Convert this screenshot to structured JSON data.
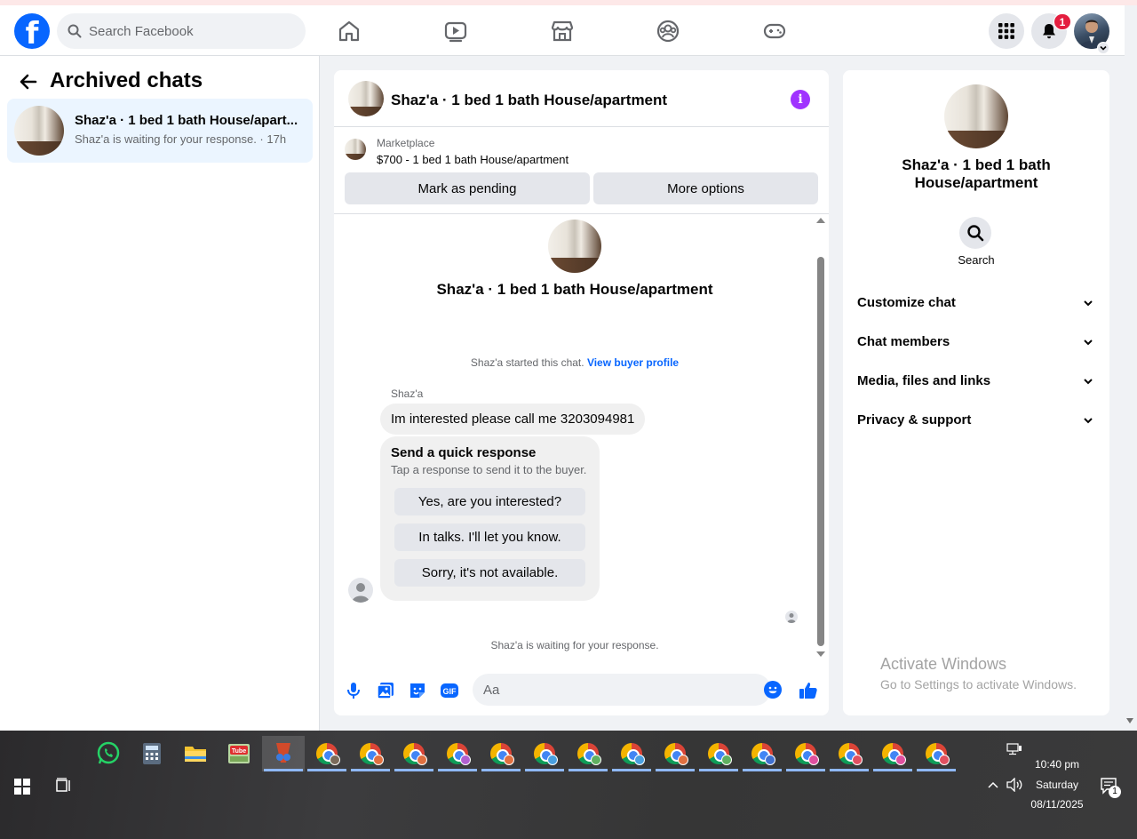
{
  "topbar": {
    "search_placeholder": "Search Facebook",
    "notifications_count": "1",
    "nav_items": [
      "home-icon",
      "watch-icon",
      "marketplace-icon",
      "groups-icon",
      "gaming-icon"
    ]
  },
  "left": {
    "title": "Archived chats",
    "chats": [
      {
        "name": "Shaz'a · 1 bed 1 bath House/apart...",
        "preview": "Shaz'a is waiting for your response. · 17h"
      }
    ]
  },
  "conversation": {
    "title": "Shaz'a · 1 bed 1 bath House/apartment",
    "marketplace_label": "Marketplace",
    "listing": "$700 - 1 bed 1 bath House/apartment",
    "mark_pending_label": "Mark as pending",
    "more_options_label": "More options",
    "thread_title": "Shaz'a · 1 bed 1 bath House/apartment",
    "started_text": "Shaz'a started this chat.",
    "buyer_profile_link": "View buyer profile",
    "sender_name": "Shaz'a",
    "message": "Im interested please call me 3203094981",
    "quick_title": "Send a quick response",
    "quick_sub": "Tap a response to send it to the buyer.",
    "quick_responses": [
      "Yes, are you interested?",
      "In talks. I'll let you know.",
      "Sorry, it's not available."
    ],
    "waiting_text": "Shaz'a is waiting for your response.",
    "composer_placeholder": "Aa"
  },
  "details": {
    "title": "Shaz'a · 1 bed 1 bath House/apartment",
    "search_label": "Search",
    "sections": [
      "Customize chat",
      "Chat members",
      "Media, files and links",
      "Privacy & support"
    ],
    "activate_title": "Activate Windows",
    "activate_sub": "Go to Settings to activate Windows."
  },
  "taskbar": {
    "time": "10:40 pm",
    "day": "Saturday",
    "date": "08/11/2025",
    "notification_count": "1",
    "chrome_profile_colors": [
      "#7a6a5a",
      "#e07040",
      "#e07040",
      "#b060d0",
      "#e07040",
      "#4aa0e0",
      "#60b060",
      "#4aa0e0",
      "#e07040",
      "#60b060",
      "#4070d0",
      "#e050a0",
      "#e05060",
      "#e050a0",
      "#e05060"
    ]
  },
  "colors": {
    "brand": "#0866ff",
    "info": "#a033ff",
    "badge": "#e41e3f"
  }
}
